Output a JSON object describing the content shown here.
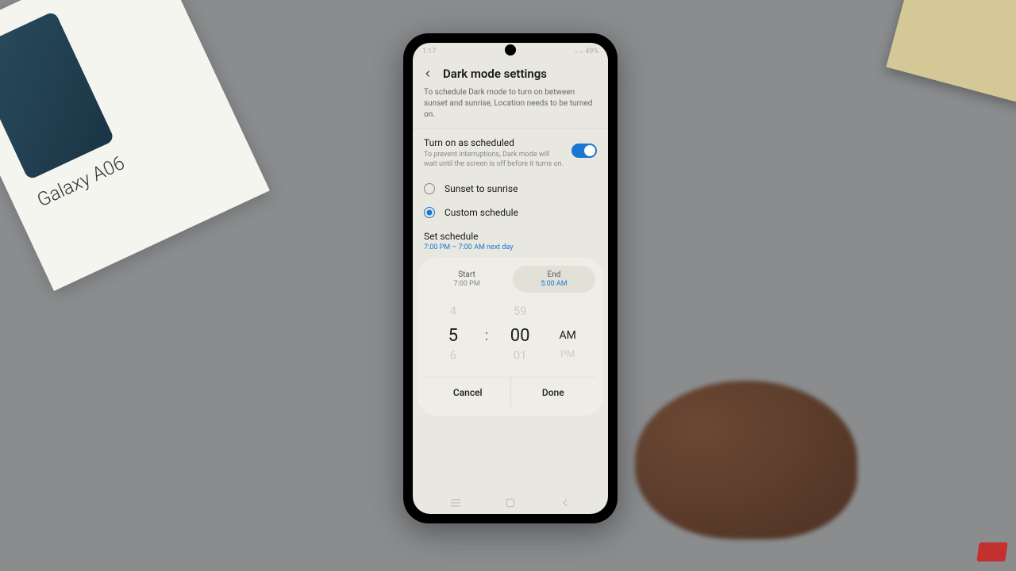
{
  "status": {
    "time": "1:17",
    "battery": "49%"
  },
  "header": {
    "title": "Dark mode settings"
  },
  "description": "To schedule Dark mode to turn on between sunset and sunrise, Location needs to be turned on.",
  "schedule_toggle": {
    "title": "Turn on as scheduled",
    "subtitle": "To prevent interruptions, Dark mode will wait until the screen is off before it turns on.",
    "enabled": true
  },
  "radios": {
    "sunset": "Sunset to sunrise",
    "custom": "Custom schedule"
  },
  "set_schedule": {
    "label": "Set schedule",
    "value": "7:00 PM – 7:00 AM next day"
  },
  "tabs": {
    "start": {
      "label": "Start",
      "time": "7:00 PM"
    },
    "end": {
      "label": "End",
      "time": "5:00 AM"
    }
  },
  "picker": {
    "hour_prev": "4",
    "hour": "5",
    "hour_next": "6",
    "min_prev": "59",
    "min": "00",
    "min_next": "01",
    "ampm": "AM",
    "ampm_next": "PM"
  },
  "buttons": {
    "cancel": "Cancel",
    "done": "Done"
  },
  "box_label": "Galaxy A06"
}
